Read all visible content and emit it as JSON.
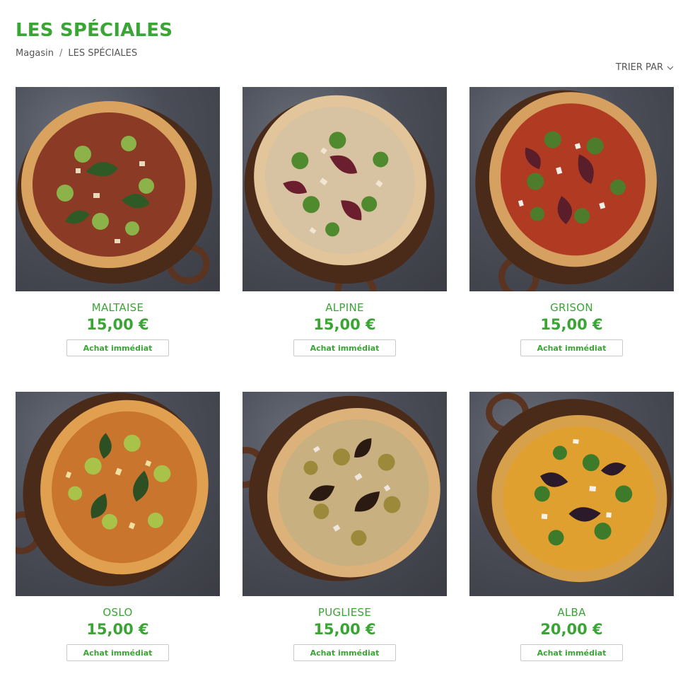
{
  "header": {
    "title": "LES SPÉCIALES",
    "breadcrumb": {
      "home": "Magasin",
      "separator": "/",
      "current": "LES SPÉCIALES"
    },
    "sort_label": "TRIER PAR"
  },
  "colors": {
    "accent": "#3aa535",
    "button_border": "#c9c9c9"
  },
  "products": [
    {
      "name": "MALTAISE",
      "price": "15,00 €",
      "button": "Achat immédiat",
      "image": "pizza-courgette-spinach"
    },
    {
      "name": "ALPINE",
      "price": "15,00 €",
      "button": "Achat immédiat",
      "image": "pizza-arugula-balsamic"
    },
    {
      "name": "GRISON",
      "price": "15,00 €",
      "button": "Achat immédiat",
      "image": "pizza-beetroot-arugula"
    },
    {
      "name": "OSLO",
      "price": "15,00 €",
      "button": "Achat immédiat",
      "image": "pizza-courgette-sesame"
    },
    {
      "name": "PUGLIESE",
      "price": "15,00 €",
      "button": "Achat immédiat",
      "image": "pizza-balsamic-drizzle"
    },
    {
      "name": "ALBA",
      "price": "20,00 €",
      "button": "Achat immédiat",
      "image": "pizza-butternut-feta"
    }
  ]
}
